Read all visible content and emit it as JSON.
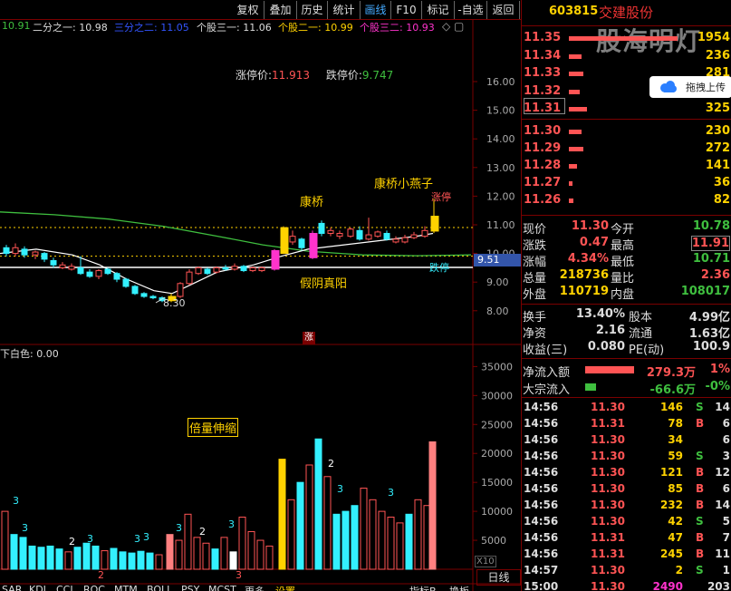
{
  "menu": [
    "复权",
    "叠加",
    "历史",
    "统计",
    "画线",
    "F10",
    "标记",
    "-自选",
    "返回"
  ],
  "legend": {
    "v0": "10.91",
    "l1": "二分之一: 10.98",
    "l2": "三分之二: 11.05",
    "l3": "个股三一: 11.06",
    "l4": "个股二一: 10.99",
    "l5": "个股三二: 10.93"
  },
  "limits": {
    "up_label": "涨停价:",
    "up": "11.913",
    "down_label": "跌停价:",
    "down": "9.747"
  },
  "price_axis": [
    "16.00",
    "15.00",
    "14.00",
    "13.00",
    "12.00",
    "11.00",
    "10.00",
    "9.00",
    "8.00"
  ],
  "price_tag": "9.51",
  "low_label": "8.30",
  "annotations": {
    "kangqiao": "康桥",
    "swallow": "康桥小燕子",
    "fake_yin": "假阴真阳",
    "zhangting": "涨停",
    "dieting": "跌停",
    "zhang": "涨",
    "vol_label": "倍量伸缩",
    "lower_title": "下白色: 0.00",
    "x10": "X10"
  },
  "vol_axis": [
    "35000",
    "30000",
    "25000",
    "20000",
    "15000",
    "10000",
    "5000"
  ],
  "count_labels": [
    "3",
    "3",
    "2",
    "3",
    "3",
    "3",
    "2",
    "3",
    "3",
    "2",
    "3",
    "3"
  ],
  "bottom_tabs": [
    "SAR",
    "KDJ",
    "CCI",
    "ROC",
    "MTM",
    "BOLL",
    "PSY",
    "MCST",
    "更多",
    "设置",
    "指标B",
    "换板"
  ],
  "period_marks": [
    "2",
    "3"
  ],
  "stock": {
    "code": "603815",
    "name": "交建股份",
    "watermark": "股海明灯",
    "popup": "拖拽上传"
  },
  "orderbook": [
    {
      "price": "11.35",
      "vol": "1954",
      "bar": 120
    },
    {
      "price": "11.34",
      "vol": "236",
      "bar": 14
    },
    {
      "price": "11.33",
      "vol": "281",
      "bar": 16
    },
    {
      "price": "11.32",
      "vol": "175",
      "bar": 12
    },
    {
      "price": "11.31",
      "vol": "325",
      "bar": 20
    },
    {
      "price": "11.30",
      "vol": "230",
      "bar": 14
    },
    {
      "price": "11.29",
      "vol": "272",
      "bar": 16
    },
    {
      "price": "11.28",
      "vol": "141",
      "bar": 9
    },
    {
      "price": "11.27",
      "vol": "36",
      "bar": 4
    },
    {
      "price": "11.26",
      "vol": "82",
      "bar": 5
    }
  ],
  "quote": [
    {
      "l1": "现价",
      "v1": "11.30",
      "l2": "今开",
      "v2": "10.78"
    },
    {
      "l1": "涨跌",
      "v1": "0.47",
      "l2": "最高",
      "v2": "11.91"
    },
    {
      "l1": "涨幅",
      "v1": "4.34%",
      "l2": "最低",
      "v2": "10.71"
    },
    {
      "l1": "总量",
      "v1": "218736",
      "l2": "量比",
      "v2": "2.36"
    },
    {
      "l1": "外盘",
      "v1": "110719",
      "l2": "内盘",
      "v2": "108017"
    }
  ],
  "quote2": [
    {
      "l1": "换手",
      "v1": "13.40%",
      "l2": "股本",
      "v2": "4.99亿"
    },
    {
      "l1": "净资",
      "v1": "2.16",
      "l2": "流通",
      "v2": "1.63亿"
    },
    {
      "l1": "收益(三)",
      "v1": "0.080",
      "l2": "PE(动)",
      "v2": "100.9"
    }
  ],
  "flows": [
    {
      "label": "净流入额",
      "value": "279.3万",
      "pct": "1%"
    },
    {
      "label": "大宗流入",
      "value": "-66.6万",
      "pct": "-0%"
    }
  ],
  "ticks": [
    {
      "t": "14:56",
      "p": "11.30",
      "v": "146",
      "s": "S",
      "n": "14"
    },
    {
      "t": "14:56",
      "p": "11.31",
      "v": "78",
      "s": "B",
      "n": "6"
    },
    {
      "t": "14:56",
      "p": "11.30",
      "v": "34",
      "s": "",
      "n": "6"
    },
    {
      "t": "14:56",
      "p": "11.30",
      "v": "59",
      "s": "S",
      "n": "3"
    },
    {
      "t": "14:56",
      "p": "11.30",
      "v": "121",
      "s": "B",
      "n": "12"
    },
    {
      "t": "14:56",
      "p": "11.30",
      "v": "85",
      "s": "B",
      "n": "6"
    },
    {
      "t": "14:56",
      "p": "11.30",
      "v": "232",
      "s": "B",
      "n": "14"
    },
    {
      "t": "14:56",
      "p": "11.30",
      "v": "42",
      "s": "S",
      "n": "5"
    },
    {
      "t": "14:56",
      "p": "11.31",
      "v": "47",
      "s": "B",
      "n": "7"
    },
    {
      "t": "14:56",
      "p": "11.31",
      "v": "245",
      "s": "B",
      "n": "11"
    },
    {
      "t": "14:57",
      "p": "11.30",
      "v": "2",
      "s": "S",
      "n": "1"
    },
    {
      "t": "15:00",
      "p": "11.30",
      "v": "2490",
      "s": "",
      "n": "203"
    }
  ],
  "day_tab": "日线",
  "colors": {
    "up": "#ff5454",
    "down": "#33f0ff",
    "ma": "#ffffff",
    "ma2": "#3fbf3f",
    "yellow": "#ffd200",
    "magenta": "#ff33cc"
  }
}
